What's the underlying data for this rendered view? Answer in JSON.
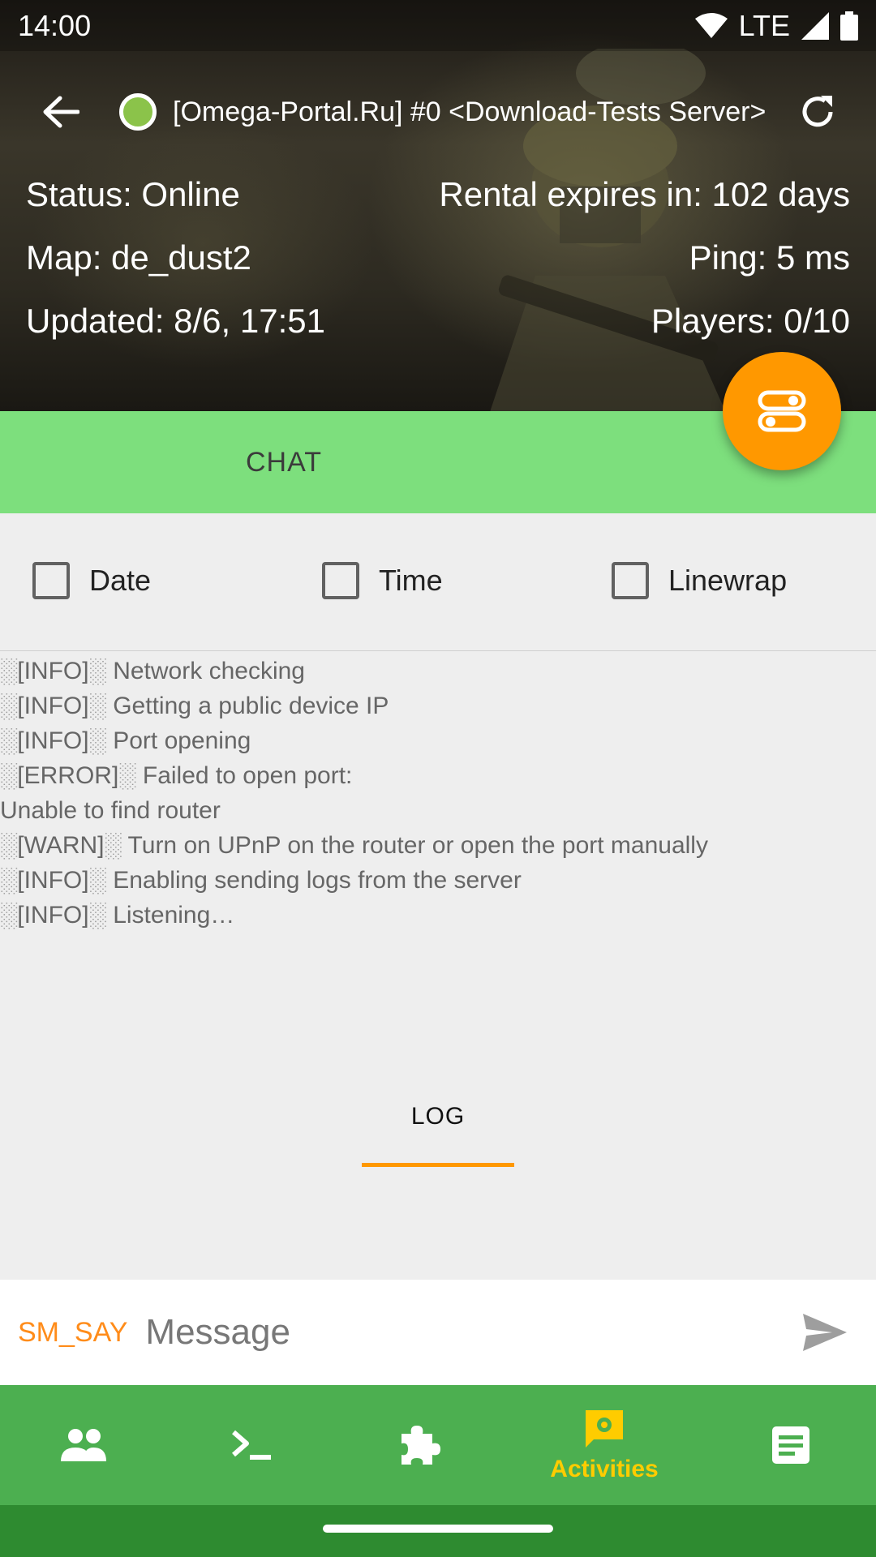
{
  "status_bar": {
    "time": "14:00",
    "network": "LTE"
  },
  "server": {
    "title": "[Omega-Portal.Ru] #0 <Download-Tests Server>",
    "status": "Status: Online",
    "rental": "Rental expires in: 102 days",
    "map": "Map: de_dust2",
    "ping": "Ping: 5 ms",
    "updated": "Updated: 8/6, 17:51",
    "players": "Players: 0/10"
  },
  "tabs": [
    {
      "label": "CHAT",
      "selected": false
    },
    {
      "label": "LOG",
      "selected": true
    }
  ],
  "options": {
    "date": {
      "label": "Date",
      "checked": false
    },
    "time": {
      "label": "Time",
      "checked": false
    },
    "linewrap": {
      "label": "Linewrap",
      "checked": false
    }
  },
  "log": [
    {
      "tag": "[INFO]",
      "text": " Network checking"
    },
    {
      "tag": "[INFO]",
      "text": " Getting a public device IP"
    },
    {
      "tag": "[INFO]",
      "text": " Port opening"
    },
    {
      "tag": "[ERROR]",
      "text": " Failed to open port:"
    },
    {
      "tag": "",
      "text": "Unable to find router"
    },
    {
      "tag": "[WARN]",
      "text": " Turn on UPnP on the router or open the port manually"
    },
    {
      "tag": "[INFO]",
      "text": " Enabling sending logs from the server"
    },
    {
      "tag": "[INFO]",
      "text": " Listening…"
    }
  ],
  "message": {
    "prefix": "SM_SAY",
    "placeholder": "Message"
  },
  "bottom_nav": {
    "items": [
      {
        "icon": "players-icon",
        "label": ""
      },
      {
        "icon": "console-icon",
        "label": ""
      },
      {
        "icon": "plugins-icon",
        "label": ""
      },
      {
        "icon": "activities-icon",
        "label": "Activities",
        "selected": true
      },
      {
        "icon": "logs-icon",
        "label": ""
      }
    ]
  },
  "colors": {
    "accent": "#ff9800",
    "tab_bar": "#7ddf7d",
    "nav_bar": "#4caf50",
    "online": "#8bc34a",
    "nav_selected": "#ffcc00"
  }
}
